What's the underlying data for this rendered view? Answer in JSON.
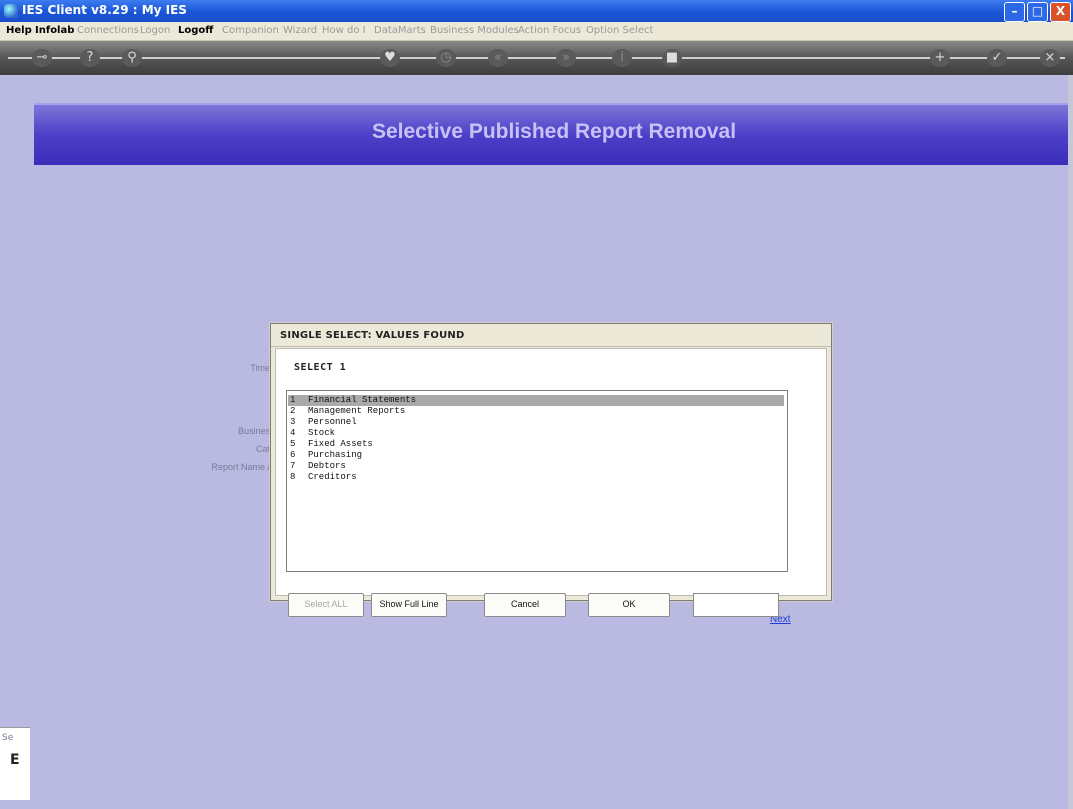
{
  "window": {
    "title": "IES Client v8.29 : My IES",
    "minimize": "–",
    "maximize": "□",
    "close": "X"
  },
  "menu": {
    "items": [
      {
        "label": "Help",
        "enabled": true
      },
      {
        "label": "Infolab",
        "enabled": true
      },
      {
        "label": "Connections",
        "enabled": false
      },
      {
        "label": "Logon",
        "enabled": false
      },
      {
        "label": "Logoff",
        "enabled": true
      },
      {
        "label": "Companion",
        "enabled": false
      },
      {
        "label": "Wizard",
        "enabled": false
      },
      {
        "label": "How do I",
        "enabled": false
      },
      {
        "label": "DataMarts",
        "enabled": false
      },
      {
        "label": "Business Modules",
        "enabled": false
      },
      {
        "label": "Action Focus",
        "enabled": false
      },
      {
        "label": "Option Select",
        "enabled": false
      }
    ]
  },
  "toolbar": {
    "icons": [
      {
        "name": "key-icon",
        "glyph": "⊸"
      },
      {
        "name": "help-icon",
        "glyph": "?"
      },
      {
        "name": "search-icon",
        "glyph": "⚲"
      },
      {
        "name": "heart-icon",
        "glyph": "♥"
      },
      {
        "name": "clock-icon",
        "glyph": "◷"
      },
      {
        "name": "rewind-icon",
        "glyph": "«"
      },
      {
        "name": "forward-icon",
        "glyph": "»"
      },
      {
        "name": "info-icon",
        "glyph": "i"
      },
      {
        "name": "stop-icon",
        "glyph": "■"
      },
      {
        "name": "plus-icon",
        "glyph": "+"
      },
      {
        "name": "check-icon",
        "glyph": "✓"
      },
      {
        "name": "close-icon",
        "glyph": "×"
      }
    ]
  },
  "banner": {
    "title": "Selective Published Report Removal"
  },
  "background_labels": {
    "time": "Time",
    "business": "Busines",
    "category": "Cat",
    "report_name": "Report Name /",
    "next": "Next",
    "bottom_stub": "Se",
    "bottom_letter": "E"
  },
  "dialog": {
    "title": "SINGLE SELECT: VALUES FOUND",
    "caption": "SELECT 1",
    "items": [
      {
        "num": "1",
        "label": "Financial Statements",
        "selected": true
      },
      {
        "num": "2",
        "label": "Management Reports",
        "selected": false
      },
      {
        "num": "3",
        "label": "Personnel",
        "selected": false
      },
      {
        "num": "4",
        "label": "Stock",
        "selected": false
      },
      {
        "num": "5",
        "label": "Fixed Assets",
        "selected": false
      },
      {
        "num": "6",
        "label": "Purchasing",
        "selected": false
      },
      {
        "num": "7",
        "label": "Debtors",
        "selected": false
      },
      {
        "num": "8",
        "label": "Creditors",
        "selected": false
      }
    ],
    "buttons": {
      "select_all": "Select ALL",
      "show_full_line": "Show Full Line",
      "cancel": "Cancel",
      "ok": "OK"
    },
    "input_value": ""
  }
}
